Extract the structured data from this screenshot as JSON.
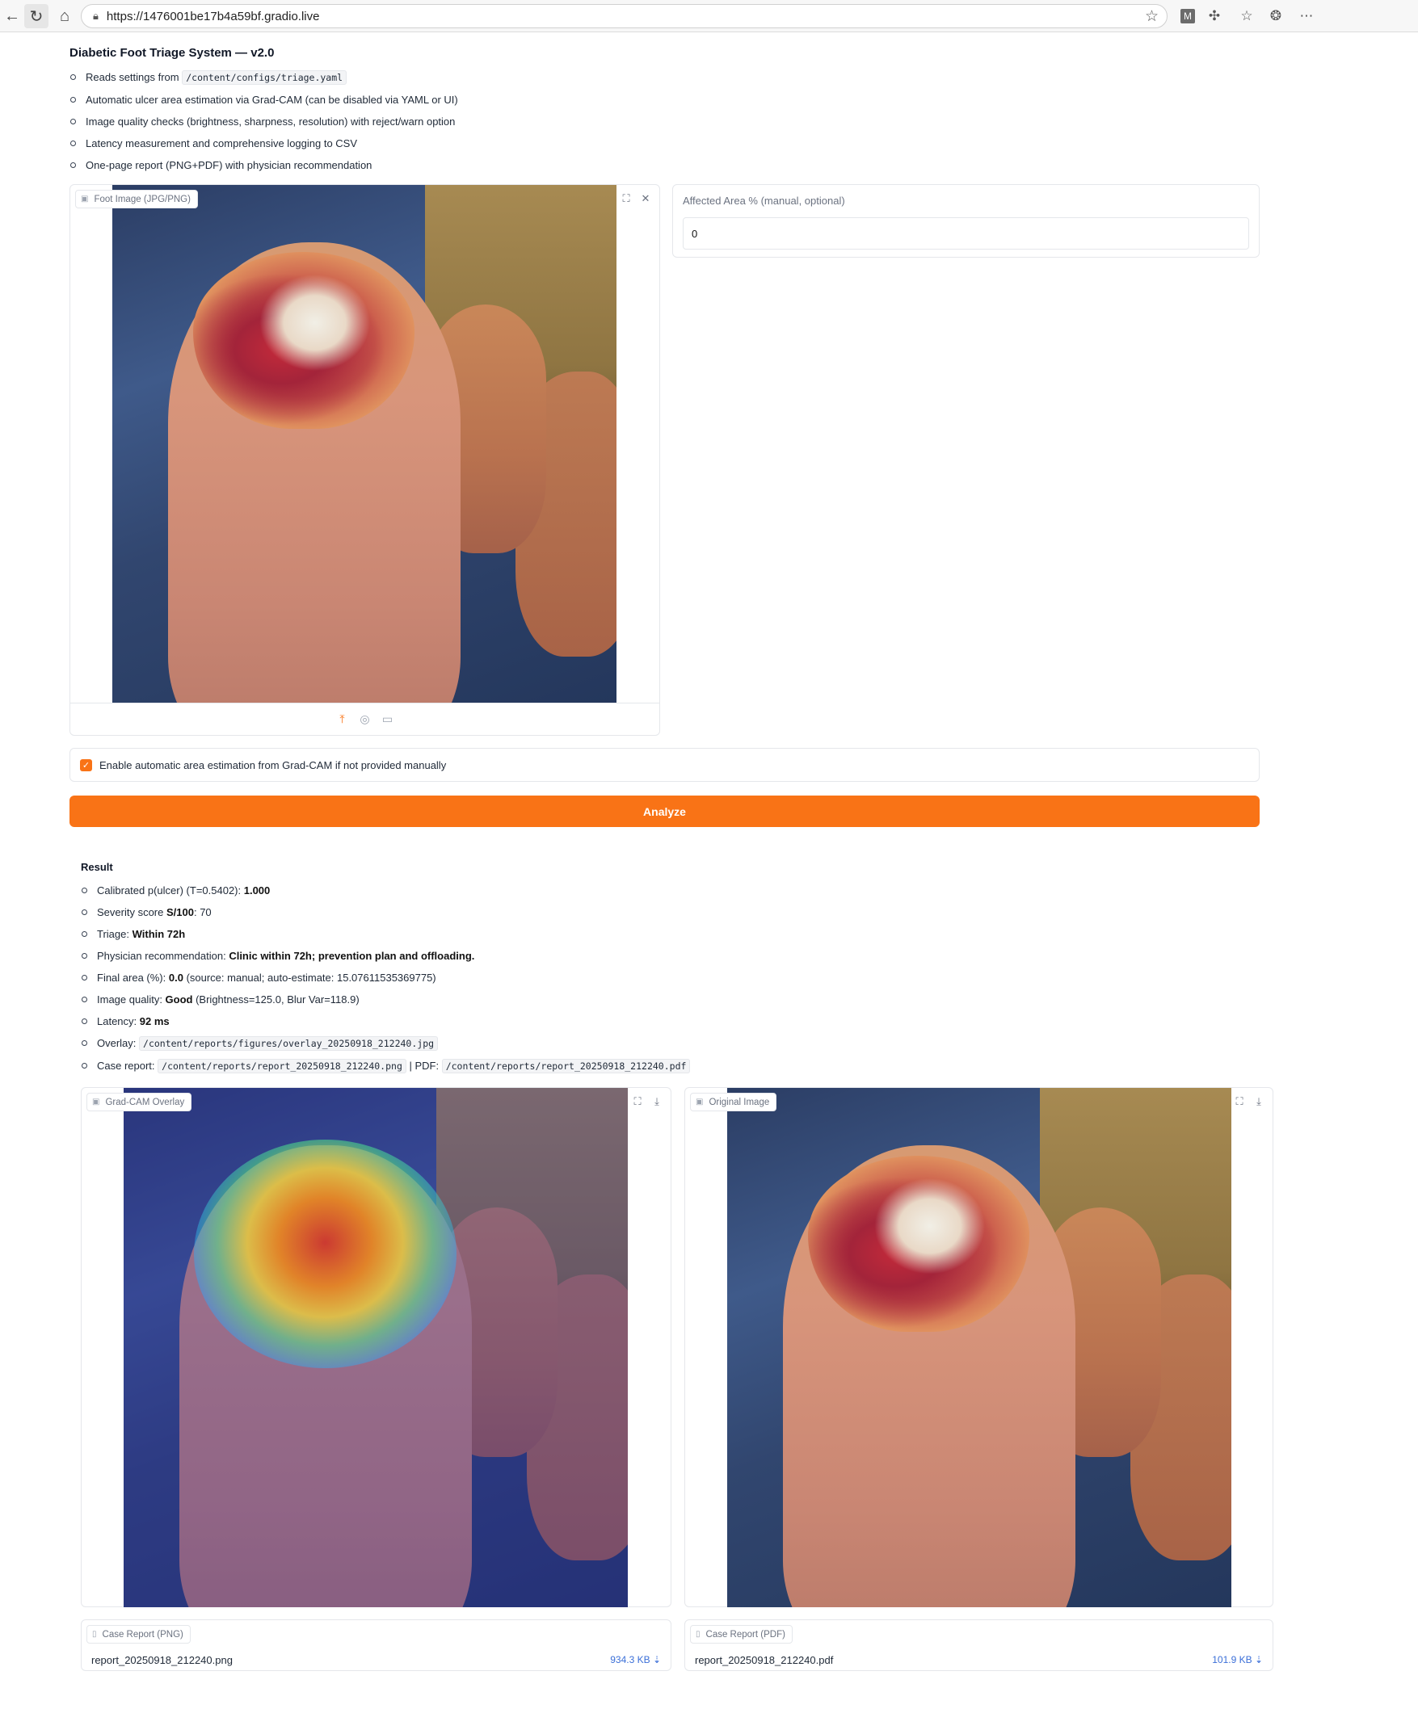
{
  "browser": {
    "url": "https://1476001be17b4a59bf.gradio.live"
  },
  "app": {
    "title": "Diabetic Foot Triage System — v2.0",
    "features": [
      {
        "pre": "Reads settings from ",
        "code": "/content/configs/triage.yaml",
        "post": ""
      },
      {
        "pre": "Automatic ulcer area estimation via Grad-CAM (can be disabled via YAML or UI)",
        "code": "",
        "post": ""
      },
      {
        "pre": "Image quality checks (brightness, sharpness, resolution) with reject/warn option",
        "code": "",
        "post": ""
      },
      {
        "pre": "Latency measurement and comprehensive logging to CSV",
        "code": "",
        "post": ""
      },
      {
        "pre": "One-page report (PNG+PDF) with physician recommendation",
        "code": "",
        "post": ""
      }
    ]
  },
  "input": {
    "image_label": "Foot Image (JPG/PNG)",
    "area_label": "Affected Area % (manual, optional)",
    "area_value": "0",
    "auto_area_label": "Enable automatic area estimation from Grad-CAM if not provided manually",
    "auto_area_checked": true,
    "analyze_label": "Analyze"
  },
  "result": {
    "heading": "Result",
    "lines": [
      {
        "label": "Calibrated p(ulcer) (T=0.5402): ",
        "value": "1.000",
        "rest": ""
      },
      {
        "label": "Severity score ",
        "value": "S/100",
        "rest": ": 70"
      },
      {
        "label": "Triage: ",
        "value": "Within 72h",
        "rest": ""
      },
      {
        "label": "Physician recommendation: ",
        "value": "Clinic within 72h; prevention plan and offloading.",
        "rest": ""
      },
      {
        "label": "Final area (%): ",
        "value": "0.0",
        "rest": " (source: manual; auto-estimate: 15.07611535369775)"
      },
      {
        "label": "Image quality: ",
        "value": "Good",
        "rest": " (Brightness=125.0, Blur Var=118.9)"
      },
      {
        "label": "Latency: ",
        "value": "92 ms",
        "rest": ""
      }
    ],
    "overlay_label": "Overlay: ",
    "overlay_path": "/content/reports/figures/overlay_20250918_212240.jpg",
    "report_label": "Case report: ",
    "report_png_path": "/content/reports/report_20250918_212240.png",
    "report_sep": " | PDF: ",
    "report_pdf_path": "/content/reports/report_20250918_212240.pdf"
  },
  "outputs": {
    "overlay_title": "Grad-CAM Overlay",
    "original_title": "Original Image",
    "png_panel_title": "Case Report (PNG)",
    "png_file": "report_20250918_212240.png",
    "png_size": "934.3 KB ⇣",
    "pdf_panel_title": "Case Report (PDF)",
    "pdf_file": "report_20250918_212240.pdf",
    "pdf_size": "101.9 KB ⇣"
  },
  "colors": {
    "accent": "#f97316",
    "link": "#3b6fd8"
  },
  "icons": [
    "back-icon",
    "refresh-icon",
    "home-icon",
    "lock-icon",
    "star-icon",
    "extension-icon",
    "favorites-icon",
    "copilot-icon",
    "more-icon",
    "image-icon",
    "fullscreen-icon",
    "close-icon",
    "upload-icon",
    "webcam-icon",
    "clipboard-icon",
    "download-icon",
    "file-icon",
    "check-icon"
  ]
}
